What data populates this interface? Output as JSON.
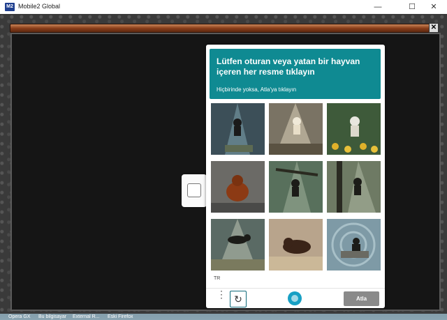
{
  "window": {
    "icon_text": "M2",
    "title": "Mobile2 Global",
    "minimize": "—",
    "maximize": "☐",
    "close": "✕"
  },
  "game": {
    "bar_close": "✕"
  },
  "captcha": {
    "title": "Lütfen oturan veya yatan bir hayvan içeren her resme tıklayın",
    "subtitle": "Hiçbirinde yoksa, Atla'ya tıklayın",
    "images": [
      {
        "name": "monkey-in-light-rays"
      },
      {
        "name": "monkey-hanging-in-light"
      },
      {
        "name": "monkey-on-flowers"
      },
      {
        "name": "orangutan-sitting"
      },
      {
        "name": "monkey-climbing-branch"
      },
      {
        "name": "monkey-hanging-tree"
      },
      {
        "name": "monkey-leaping"
      },
      {
        "name": "gorilla-lying"
      },
      {
        "name": "monkey-on-rock"
      }
    ],
    "language": "TR",
    "menu_icon": "⋮",
    "refresh_icon": "↻",
    "skip_label": "Atla"
  },
  "taskbar": {
    "items": [
      "Opera GX",
      "Bu bilgisayar",
      "External R...",
      "Eski Firefox"
    ]
  }
}
